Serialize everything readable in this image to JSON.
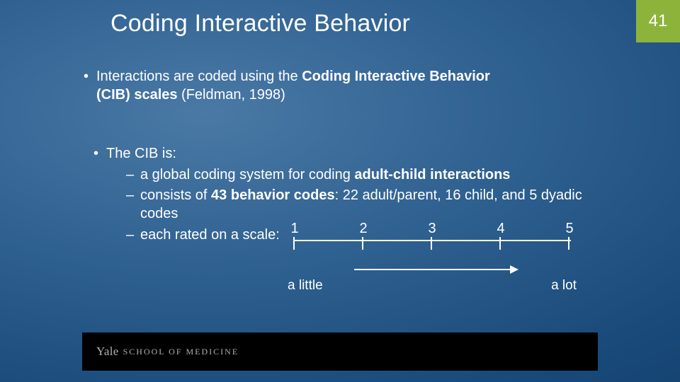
{
  "slide": {
    "title": "Coding Interactive Behavior",
    "page_number": "41"
  },
  "bullets": {
    "b1_pre": "Interactions are coded using the ",
    "b1_bold": "Coding Interactive Behavior (CIB) scales",
    "b1_post": " (Feldman, 1998)",
    "b2": "The CIB is:",
    "d1_pre": "a global coding system for coding ",
    "d1_bold": "adult-child interactions",
    "d2_pre": "consists of ",
    "d2_bold": "43 behavior codes",
    "d2_post": ": 22 adult/parent, 16 child, and 5 dyadic codes",
    "d3": "each rated on a scale:"
  },
  "scale": {
    "ticks": [
      "1",
      "2",
      "3",
      "4",
      "5"
    ],
    "low_label": "a little",
    "high_label": "a lot"
  },
  "footer": {
    "brand": "Yale",
    "rest": " SCHOOL OF MEDICINE"
  },
  "chart_data": {
    "type": "bar",
    "title": "CIB rating scale",
    "categories": [
      "1",
      "2",
      "3",
      "4",
      "5"
    ],
    "values": [
      1,
      2,
      3,
      4,
      5
    ],
    "xlabel": "",
    "ylabel": "",
    "low_anchor": "a little",
    "high_anchor": "a lot",
    "xlim": [
      1,
      5
    ]
  }
}
